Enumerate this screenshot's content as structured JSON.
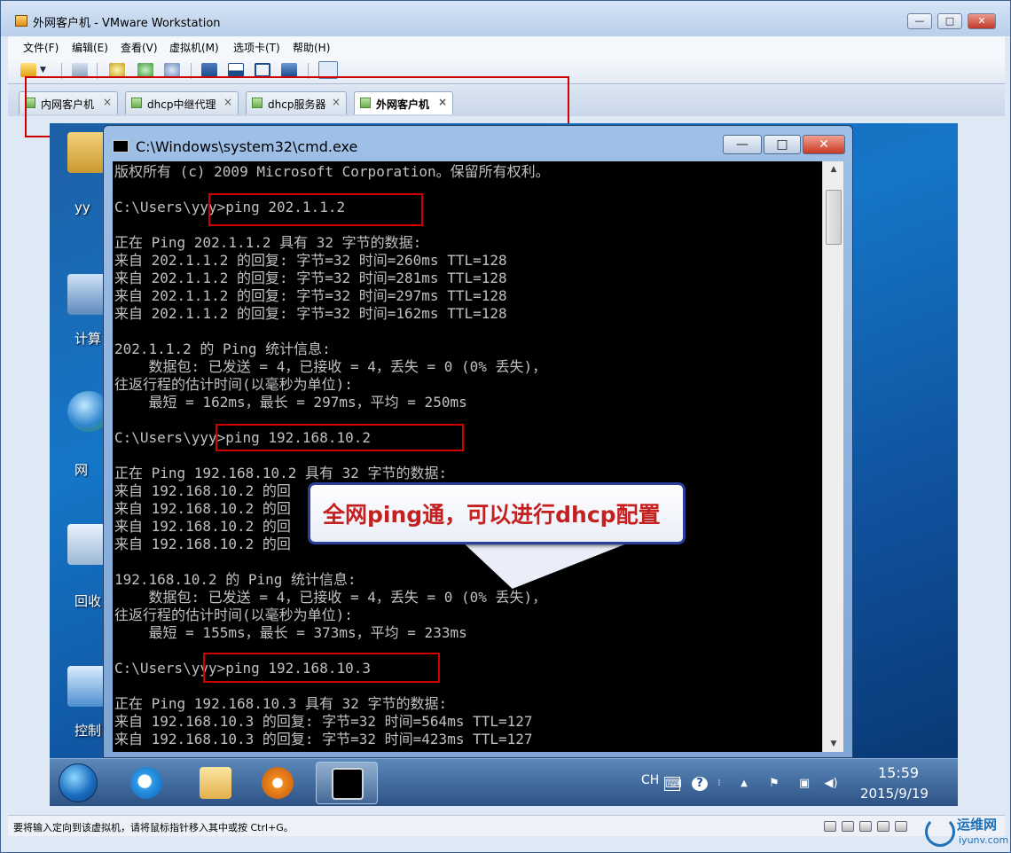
{
  "window": {
    "title": "外网客户机 - VMware Workstation",
    "controls": [
      "—",
      "□",
      "✕"
    ]
  },
  "menu": [
    "文件(F)",
    "编辑(E)",
    "查看(V)",
    "虚拟机(M)",
    "选项卡(T)",
    "帮助(H)"
  ],
  "tabs": [
    {
      "label": "内网客户机",
      "active": false
    },
    {
      "label": "dhcp中继代理",
      "active": false
    },
    {
      "label": "dhcp服务器",
      "active": false
    },
    {
      "label": "外网客户机",
      "active": true
    }
  ],
  "tab_close": "×",
  "desktop_icons": [
    "yy",
    "计算",
    "网",
    "回收",
    "控制"
  ],
  "cmd": {
    "title": "C:\\Windows\\system32\\cmd.exe",
    "controls": [
      "—",
      "□",
      "✕"
    ],
    "lines": [
      "版权所有 (c) 2009 Microsoft Corporation。保留所有权利。",
      "",
      "C:\\Users\\yyy>ping 202.1.1.2",
      "",
      "正在 Ping 202.1.1.2 具有 32 字节的数据:",
      "来自 202.1.1.2 的回复: 字节=32 时间=260ms TTL=128",
      "来自 202.1.1.2 的回复: 字节=32 时间=281ms TTL=128",
      "来自 202.1.1.2 的回复: 字节=32 时间=297ms TTL=128",
      "来自 202.1.1.2 的回复: 字节=32 时间=162ms TTL=128",
      "",
      "202.1.1.2 的 Ping 统计信息:",
      "    数据包: 已发送 = 4，已接收 = 4，丢失 = 0 (0% 丢失)，",
      "往返行程的估计时间(以毫秒为单位):",
      "    最短 = 162ms，最长 = 297ms，平均 = 250ms",
      "",
      "C:\\Users\\yyy>ping 192.168.10.2",
      "",
      "正在 Ping 192.168.10.2 具有 32 字节的数据:",
      "来自 192.168.10.2 的回",
      "来自 192.168.10.2 的回",
      "来自 192.168.10.2 的回",
      "来自 192.168.10.2 的回",
      "",
      "192.168.10.2 的 Ping 统计信息:",
      "    数据包: 已发送 = 4，已接收 = 4，丢失 = 0 (0% 丢失)，",
      "往返行程的估计时间(以毫秒为单位):",
      "    最短 = 155ms，最长 = 373ms，平均 = 233ms",
      "",
      "C:\\Users\\yyy>ping 192.168.10.3",
      "",
      "正在 Ping 192.168.10.3 具有 32 字节的数据:",
      "来自 192.168.10.3 的回复: 字节=32 时间=564ms TTL=127",
      "来自 192.168.10.3 的回复: 字节=32 时间=423ms TTL=127"
    ]
  },
  "callout": {
    "text": "全网ping通，可以进行dhcp配置"
  },
  "taskbar": {
    "language": "CH",
    "time": "15:59",
    "date": "2015/9/19"
  },
  "statusbar": {
    "text": "要将输入定向到该虚拟机，请将鼠标指针移入其中或按 Ctrl+G。"
  },
  "watermark": {
    "text": "运维网",
    "sub": "iyunv.com"
  },
  "colors": {
    "accent_red": "#d10000",
    "callout_text": "#c42020",
    "console_bg": "#000000",
    "console_text": "#c0c0c0"
  }
}
